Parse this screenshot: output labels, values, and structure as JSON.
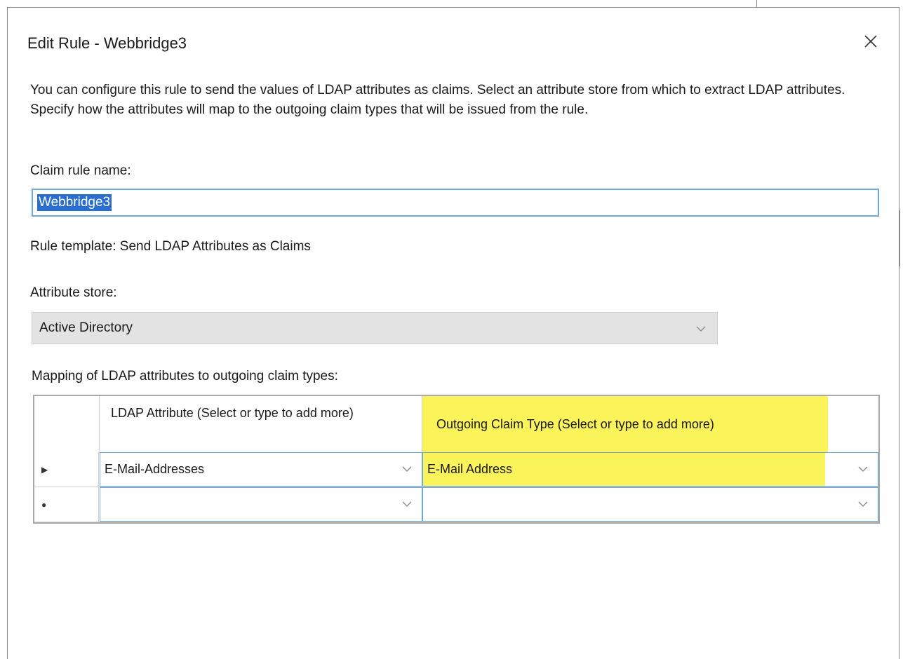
{
  "dialog": {
    "title": "Edit Rule - Webbridge3",
    "close_icon": "close-icon",
    "description": "You can configure this rule to send the values of LDAP attributes as claims. Select an attribute store from which to extract LDAP attributes. Specify how the attributes will map to the outgoing claim types that will be issued from the rule."
  },
  "claim_rule_name": {
    "label": "Claim rule name:",
    "value": "Webbridge3"
  },
  "rule_template": {
    "text": "Rule template: Send LDAP Attributes as Claims"
  },
  "attribute_store": {
    "label": "Attribute store:",
    "selected": "Active Directory"
  },
  "mapping": {
    "label": "Mapping of LDAP attributes to outgoing claim types:",
    "headers": {
      "ldap_attribute": "LDAP Attribute (Select or type to add more)",
      "outgoing_claim_type": "Outgoing Claim Type (Select or type to add more)"
    },
    "rows": [
      {
        "marker": "▶",
        "ldap_attribute": "E-Mail-Addresses",
        "outgoing_claim_type": "E-Mail Address"
      },
      {
        "marker": "●",
        "ldap_attribute": "",
        "outgoing_claim_type": ""
      }
    ],
    "highlight_color": "#fbf35a"
  },
  "colors": {
    "selection": "#2a6fcf",
    "focus_border": "#6fa8dc",
    "grid_empty": "#acacac"
  }
}
